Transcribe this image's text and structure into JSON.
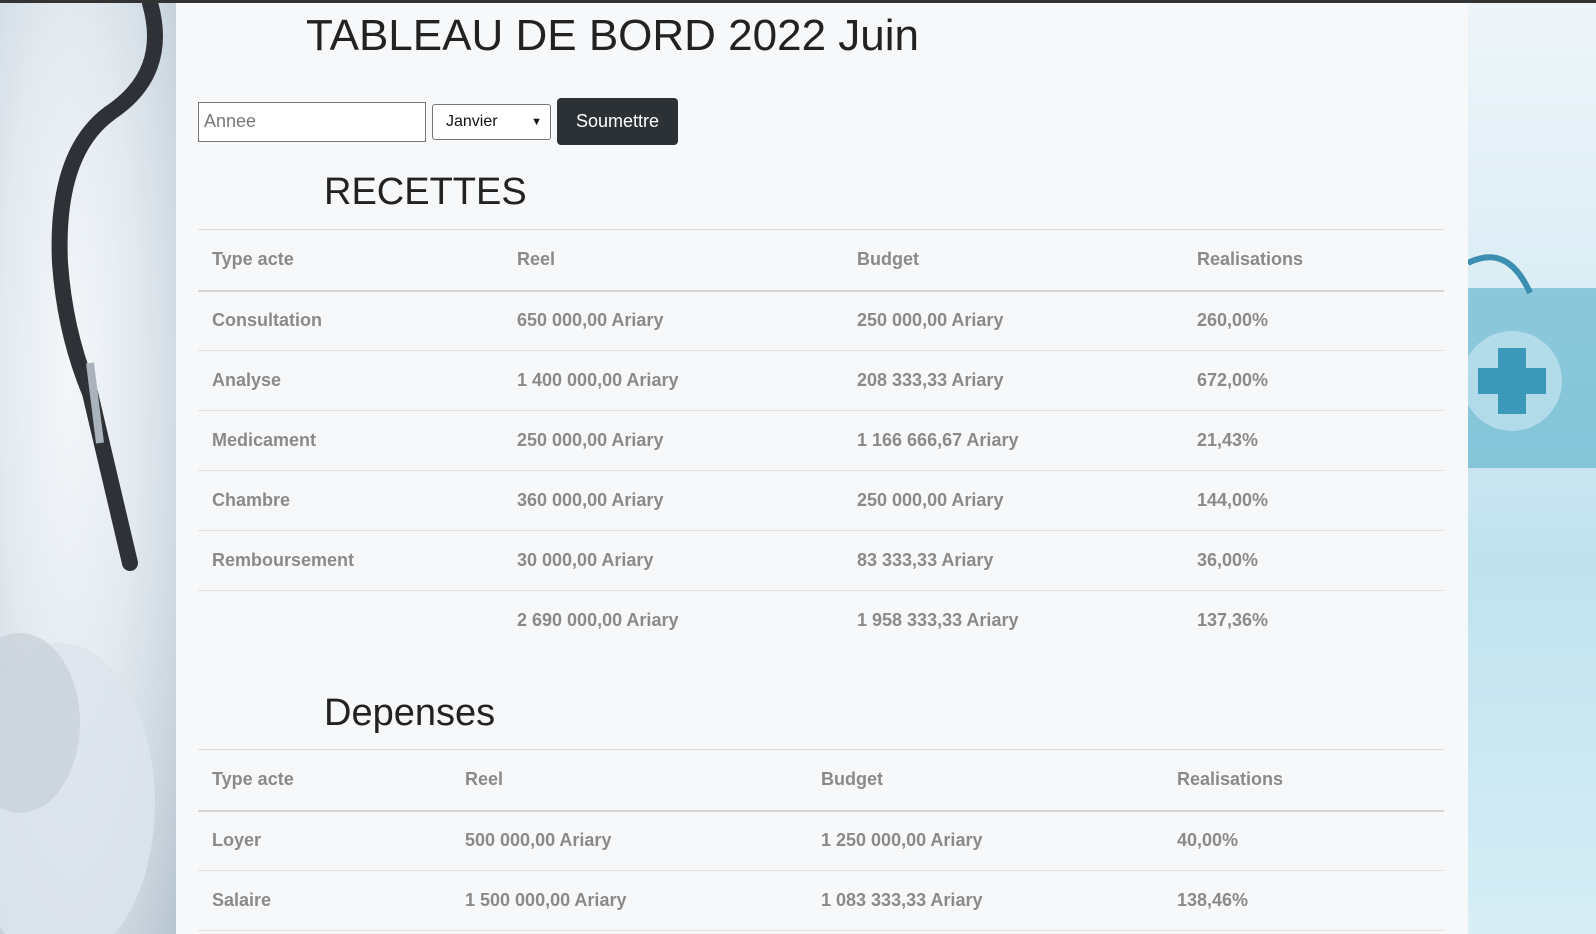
{
  "page": {
    "title": "TABLEAU DE BORD 2022 Juin"
  },
  "form": {
    "year_placeholder": "Annee",
    "month_selected": "Janvier",
    "submit_label": "Soumettre"
  },
  "recettes": {
    "title": "RECETTES",
    "headers": [
      "Type acte",
      "Reel",
      "Budget",
      "Realisations"
    ],
    "rows": [
      [
        "Consultation",
        "650 000,00 Ariary",
        "250 000,00 Ariary",
        "260,00%"
      ],
      [
        "Analyse",
        "1 400 000,00 Ariary",
        "208 333,33 Ariary",
        "672,00%"
      ],
      [
        "Medicament",
        "250 000,00 Ariary",
        "1 166 666,67 Ariary",
        "21,43%"
      ],
      [
        "Chambre",
        "360 000,00 Ariary",
        "250 000,00 Ariary",
        "144,00%"
      ],
      [
        "Remboursement",
        "30 000,00 Ariary",
        "83 333,33 Ariary",
        "36,00%"
      ]
    ],
    "total": [
      "",
      "2 690 000,00 Ariary",
      "1 958 333,33 Ariary",
      "137,36%"
    ]
  },
  "depenses": {
    "title": "Depenses",
    "headers": [
      "Type acte",
      "Reel",
      "Budget",
      "Realisations"
    ],
    "rows": [
      [
        "Loyer",
        "500 000,00 Ariary",
        "1 250 000,00 Ariary",
        "40,00%"
      ],
      [
        "Salaire",
        "1 500 000,00 Ariary",
        "1 083 333,33 Ariary",
        "138,46%"
      ]
    ]
  }
}
